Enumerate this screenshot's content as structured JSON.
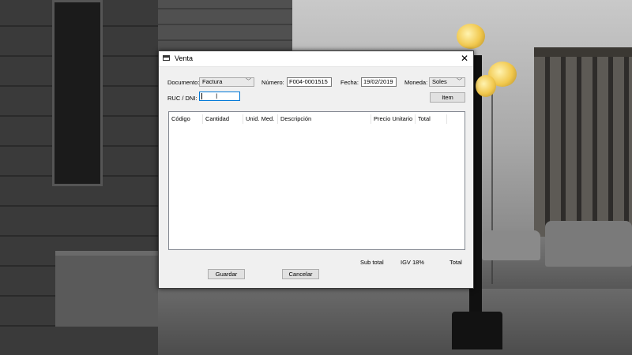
{
  "window": {
    "title": "Venta",
    "close_glyph": "✕",
    "icon": "app-window-icon"
  },
  "form": {
    "documento_label": "Documento:",
    "documento_value": "Factura",
    "numero_label": "Número:",
    "numero_value": "F004-0001515",
    "fecha_label": "Fecha:",
    "fecha_value": "19/02/2019",
    "moneda_label": "Moneda:",
    "moneda_value": "Soles",
    "ruc_label": "RUC / DNI:",
    "ruc_value": "",
    "item_button": "Item"
  },
  "table": {
    "columns": [
      "Código",
      "Cantidad",
      "Unid. Med.",
      "Descripción",
      "Precio Unitario",
      "Total"
    ],
    "rows": []
  },
  "totals": {
    "subtotal_label": "Sub total",
    "igv_label": "IGV 18%",
    "total_label": "Total"
  },
  "actions": {
    "save": "Guardar",
    "cancel": "Cancelar"
  },
  "colors": {
    "focus_border": "#0078d7",
    "lamp": "#f1c84e"
  }
}
